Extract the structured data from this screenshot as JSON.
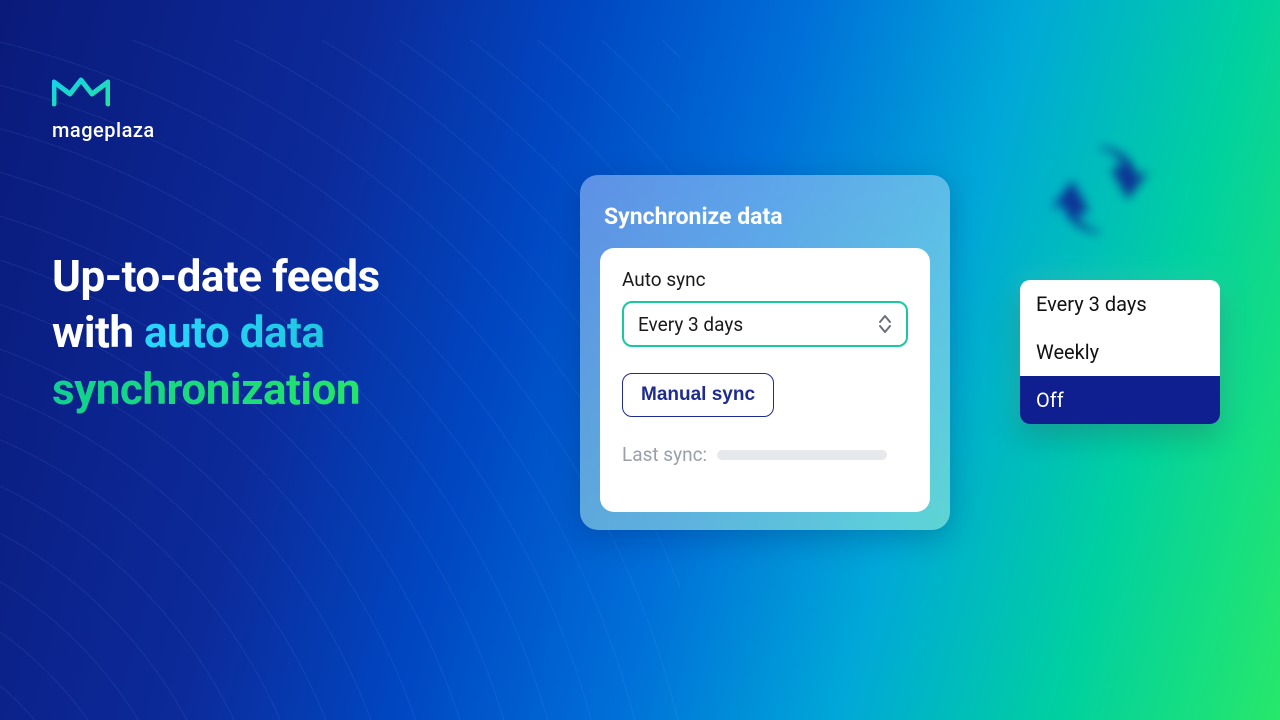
{
  "brand": {
    "name": "mageplaza"
  },
  "headline": {
    "line1": "Up-to-date feeds",
    "line2a": "with ",
    "line2b": "auto data",
    "line3": "synchronization"
  },
  "card": {
    "title": "Synchronize data",
    "auto_sync_label": "Auto sync",
    "auto_sync_value": "Every 3 days",
    "manual_sync_label": "Manual sync",
    "last_sync_label": "Last sync:"
  },
  "dropdown": {
    "options": [
      "Every 3 days",
      "Weekly",
      "Off"
    ],
    "selected": "Off"
  },
  "colors": {
    "accent_teal": "#18c9a0",
    "accent_navy": "#1e2b8f",
    "dropdown_selected_bg": "#0f1f8f"
  }
}
